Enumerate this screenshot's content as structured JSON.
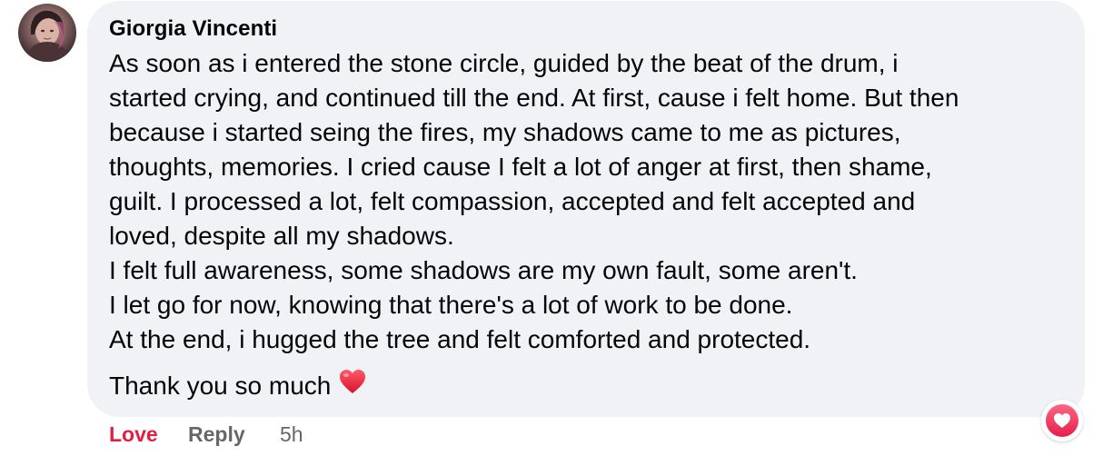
{
  "comment": {
    "author": "Giorgia Vincenti",
    "body_lines": [
      "As soon as i entered the stone circle, guided by the beat of the drum, i",
      "started crying, and continued till the end. At first, cause i felt home. But then",
      "because i started seing the fires, my shadows came to me as pictures,",
      "thoughts, memories. I cried cause I felt a lot of anger at first, then shame,",
      "guilt. I processed a lot, felt compassion, accepted and felt accepted and",
      "loved, despite all my shadows.",
      "I felt full awareness, some shadows are my own fault, some aren't.",
      "I let go for now, knowing that there's a lot of work to be done.",
      "At the end, i hugged the tree and felt comforted and protected."
    ],
    "closing": "Thank you so much",
    "closing_emoji": "red-heart-emoji",
    "reaction": "love-reaction-icon"
  },
  "actions": {
    "love_label": "Love",
    "reply_label": "Reply",
    "time_label": "5h"
  },
  "colors": {
    "bubble_bg": "#f0f2f5",
    "love_active": "#e41e3f",
    "secondary_text": "#65676b",
    "primary_text": "#050505"
  }
}
